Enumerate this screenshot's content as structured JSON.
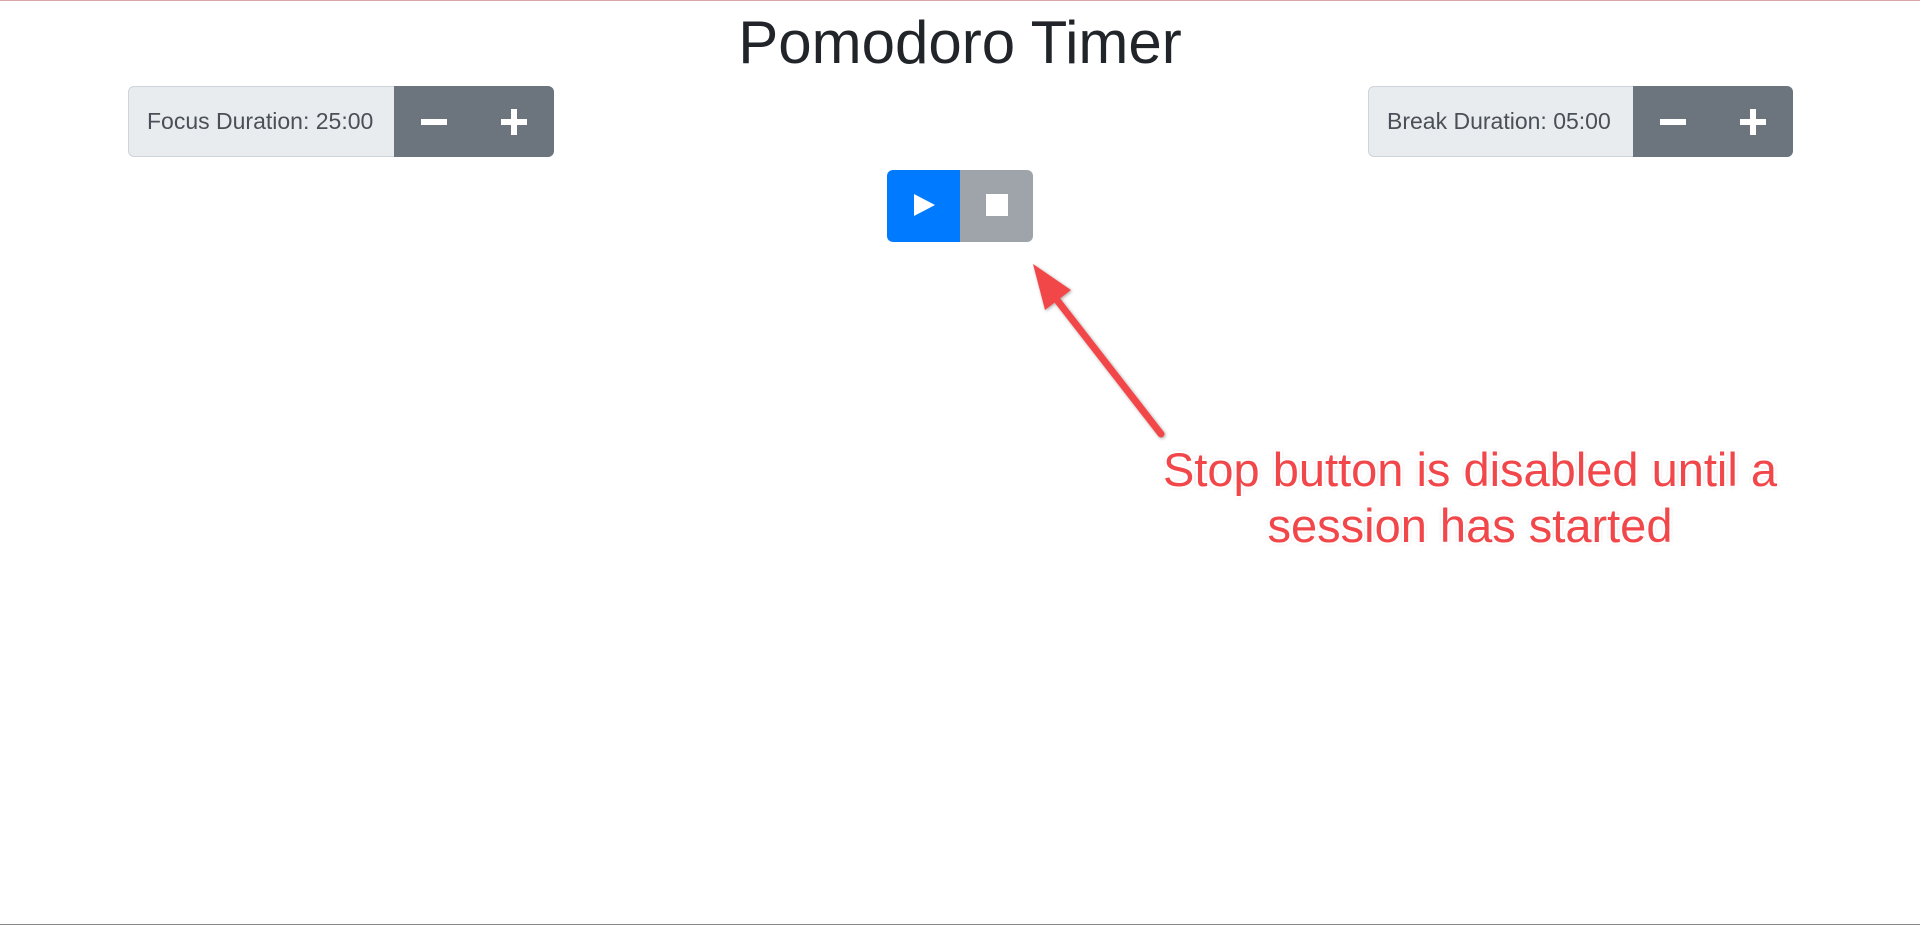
{
  "page": {
    "title": "Pomodoro Timer"
  },
  "focus": {
    "label": "Focus Duration: 25:00",
    "decrement_icon": "minus-icon",
    "increment_icon": "plus-icon"
  },
  "break": {
    "label": "Break Duration: 05:00",
    "decrement_icon": "minus-icon",
    "increment_icon": "plus-icon"
  },
  "controls": {
    "play_icon": "play-icon",
    "stop_icon": "stop-icon",
    "stop_disabled": true
  },
  "annotation": {
    "text": "Stop button is disabled until a session has started"
  },
  "colors": {
    "primary": "#007bff",
    "secondary": "#6c757d",
    "disabled": "#9ea4a9",
    "annotation": "#f2474a"
  }
}
